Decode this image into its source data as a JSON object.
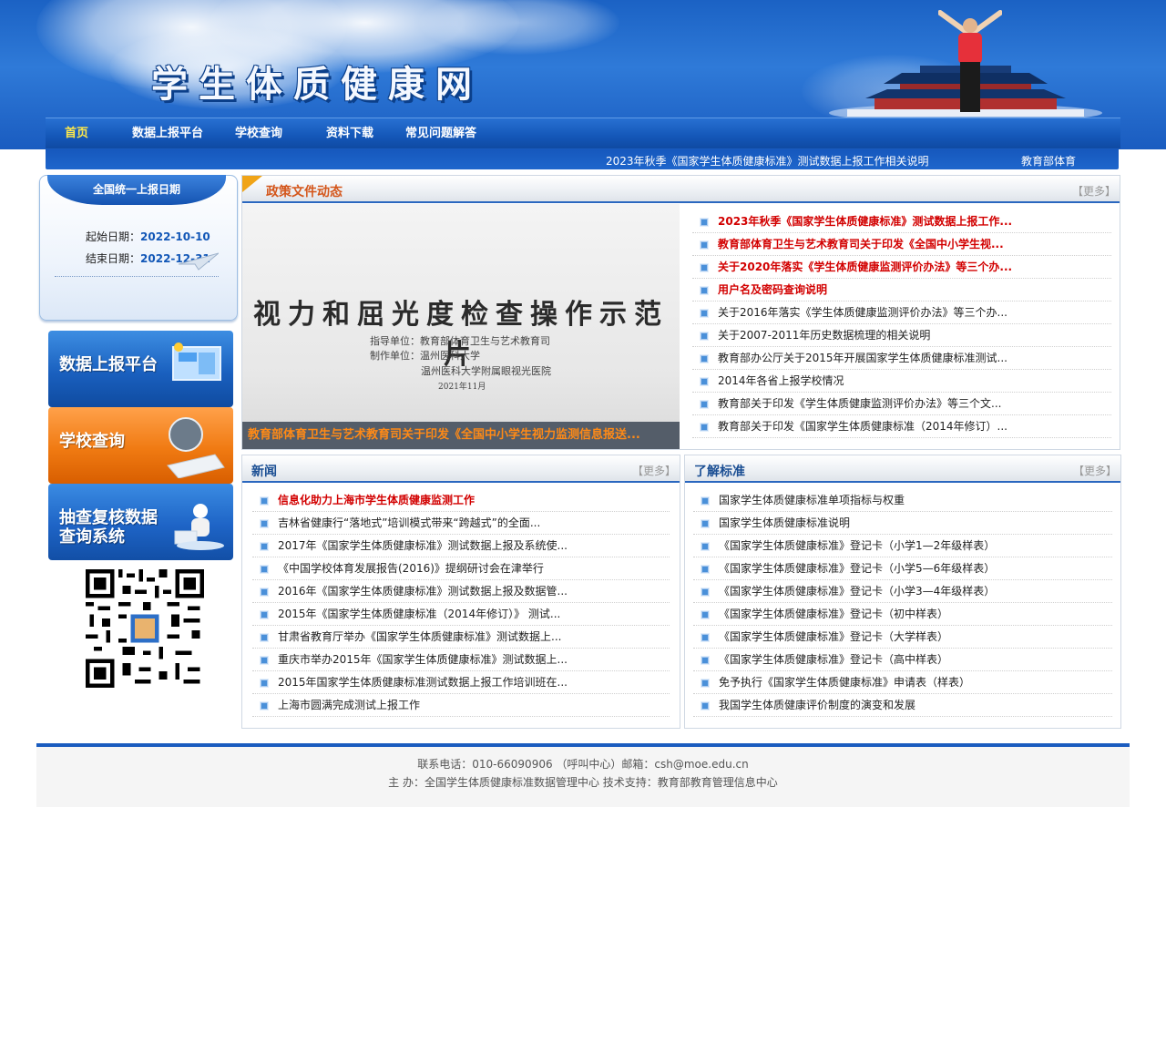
{
  "site": {
    "title": "学生体质健康网"
  },
  "nav": {
    "items": [
      {
        "label": "首页"
      },
      {
        "label": "数据上报平台"
      },
      {
        "label": "学校查询"
      },
      {
        "label": "资料下载"
      },
      {
        "label": "常见问题解答"
      }
    ]
  },
  "ticker": {
    "items": [
      "2023年秋季《国家学生体质健康标准》测试数据上报工作相关说明",
      "教育部体育"
    ]
  },
  "report_dates": {
    "heading": "全国统一上报日期",
    "start_label": "起始日期：",
    "start_value": "2022-10-10",
    "end_label": "结束日期：",
    "end_value": "2022-12-31"
  },
  "side_buttons": {
    "platform": "数据上报平台",
    "school": "学校查询",
    "recheck_line1": "抽查复核数据",
    "recheck_line2": "查询系统"
  },
  "policy": {
    "title": "政策文件动态",
    "more": "【更多】",
    "slide": {
      "title": "视力和屈光度检查操作示范片",
      "guide": "指导单位：教育部体育卫生与艺术教育司",
      "maker": "制作单位：温州医科大学",
      "maker2": "温州医科大学附属眼视光医院",
      "date": "2021年11月",
      "caption": "教育部体育卫生与艺术教育司关于印发《全国中小学生视力监测信息报送..."
    },
    "items": [
      "2023年秋季《国家学生体质健康标准》测试数据上报工作...",
      "教育部体育卫生与艺术教育司关于印发《全国中小学生视...",
      "关于2020年落实《学生体质健康监测评价办法》等三个办...",
      "用户名及密码查询说明",
      "关于2016年落实《学生体质健康监测评价办法》等三个办...",
      "关于2007-2011年历史数据梳理的相关说明",
      "教育部办公厅关于2015年开展国家学生体质健康标准测试...",
      "2014年各省上报学校情况",
      "教育部关于印发《学生体质健康监测评价办法》等三个文...",
      "教育部关于印发《国家学生体质健康标准（2014年修订）..."
    ]
  },
  "news": {
    "title": "新闻",
    "more": "【更多】",
    "items": [
      "信息化助力上海市学生体质健康监测工作",
      "吉林省健康行“落地式”培训模式带来“跨越式”的全面...",
      "2017年《国家学生体质健康标准》测试数据上报及系统使...",
      "《中国学校体育发展报告(2016)》提纲研讨会在津举行",
      "2016年《国家学生体质健康标准》测试数据上报及数据管...",
      "2015年《国家学生体质健康标准（2014年修订）》 测试...",
      "甘肃省教育厅举办《国家学生体质健康标准》测试数据上...",
      "重庆市举办2015年《国家学生体质健康标准》测试数据上...",
      "2015年国家学生体质健康标准测试数据上报工作培训班在...",
      "上海市圆满完成测试上报工作"
    ]
  },
  "standard": {
    "title": "了解标准",
    "more": "【更多】",
    "items": [
      "国家学生体质健康标准单项指标与权重",
      "国家学生体质健康标准说明",
      "《国家学生体质健康标准》登记卡（小学1—2年级样表）",
      "《国家学生体质健康标准》登记卡（小学5—6年级样表）",
      "《国家学生体质健康标准》登记卡（小学3—4年级样表）",
      "《国家学生体质健康标准》登记卡（初中样表）",
      "《国家学生体质健康标准》登记卡（大学样表）",
      "《国家学生体质健康标准》登记卡（高中样表）",
      "免予执行《国家学生体质健康标准》申请表（样表）",
      "我国学生体质健康评价制度的演变和发展"
    ]
  },
  "footer": {
    "contact": "联系电话：010-66090906 （呼叫中心）邮箱：csh@moe.edu.cn",
    "host": "主 办：全国学生体质健康标准数据管理中心 技术支持：教育部教育管理信息中心"
  }
}
